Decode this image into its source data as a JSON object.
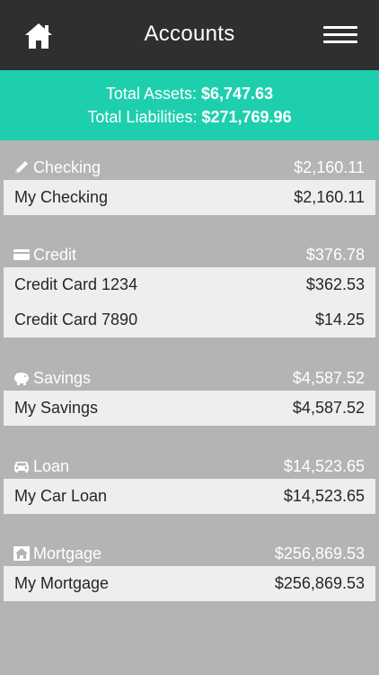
{
  "header": {
    "title": "Accounts"
  },
  "totals": {
    "assets_label": "Total Assets:",
    "assets_value": "$6,747.63",
    "liabilities_label": "Total Liabilities:",
    "liabilities_value": "$271,769.96"
  },
  "groups": [
    {
      "name": "Checking",
      "total": "$2,160.11",
      "icon": "pencil-icon",
      "accounts": [
        {
          "name": "My Checking",
          "balance": "$2,160.11"
        }
      ]
    },
    {
      "name": "Credit",
      "total": "$376.78",
      "icon": "credit-card-icon",
      "accounts": [
        {
          "name": "Credit Card 1234",
          "balance": "$362.53"
        },
        {
          "name": "Credit Card 7890",
          "balance": "$14.25"
        }
      ]
    },
    {
      "name": "Savings",
      "total": "$4,587.52",
      "icon": "piggy-bank-icon",
      "accounts": [
        {
          "name": "My Savings",
          "balance": "$4,587.52"
        }
      ]
    },
    {
      "name": "Loan",
      "total": "$14,523.65",
      "icon": "car-icon",
      "accounts": [
        {
          "name": "My Car Loan",
          "balance": "$14,523.65"
        }
      ]
    },
    {
      "name": "Mortgage",
      "total": "$256,869.53",
      "icon": "house-icon",
      "accounts": [
        {
          "name": "My Mortgage",
          "balance": "$256,869.53"
        }
      ]
    }
  ],
  "colors": {
    "topbar": "#2f2f30",
    "accent": "#1ecfae",
    "background": "#b4b4b4",
    "card": "#eeeeee"
  }
}
